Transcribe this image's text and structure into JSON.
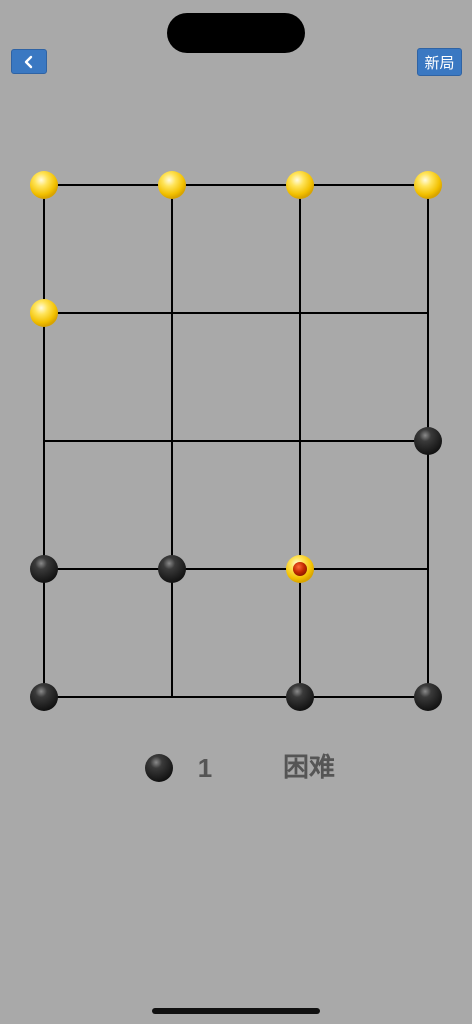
{
  "header": {
    "back_icon": "chevron-left-icon",
    "new_game_label": "新局"
  },
  "board": {
    "columns": 4,
    "rows": 5,
    "colors": {
      "yellow": "#f5c400",
      "black": "#2a2a2a",
      "selected_center": "#c42a00",
      "line": "#000000",
      "background": "#a9a9a9"
    },
    "pieces": [
      {
        "col": 0,
        "row": 0,
        "color": "yellow"
      },
      {
        "col": 1,
        "row": 0,
        "color": "yellow"
      },
      {
        "col": 2,
        "row": 0,
        "color": "yellow"
      },
      {
        "col": 3,
        "row": 0,
        "color": "yellow"
      },
      {
        "col": 0,
        "row": 1,
        "color": "yellow"
      },
      {
        "col": 3,
        "row": 2,
        "color": "black"
      },
      {
        "col": 0,
        "row": 3,
        "color": "black"
      },
      {
        "col": 1,
        "row": 3,
        "color": "black"
      },
      {
        "col": 2,
        "row": 3,
        "color": "yellow",
        "selected": true
      },
      {
        "col": 0,
        "row": 4,
        "color": "black"
      },
      {
        "col": 2,
        "row": 4,
        "color": "black"
      },
      {
        "col": 3,
        "row": 4,
        "color": "black"
      }
    ],
    "missing_segments": [
      {
        "from": [
          0,
          2
        ],
        "to": [
          0,
          3
        ],
        "note_hidden": true
      }
    ]
  },
  "status": {
    "current_player_color": "black",
    "count": "1",
    "difficulty": "困难"
  }
}
